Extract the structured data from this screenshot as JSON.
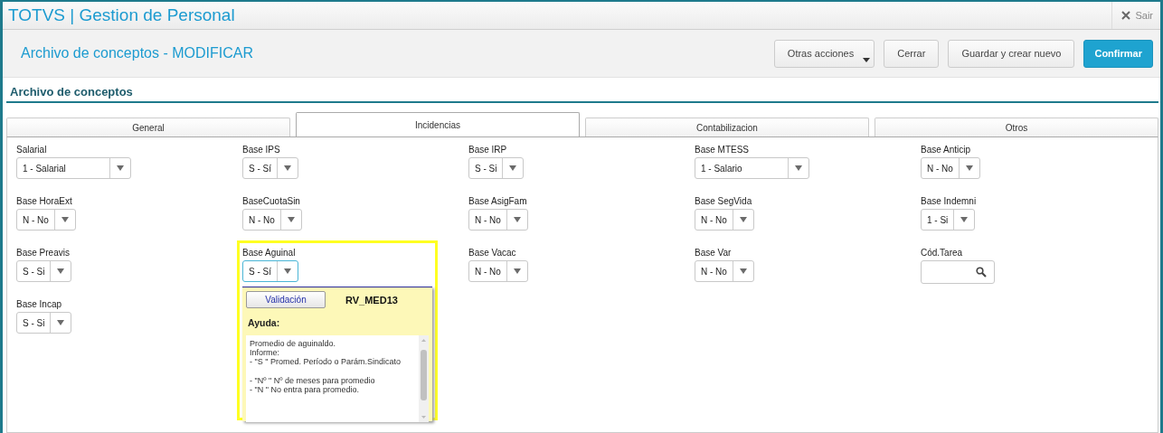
{
  "app_bar": {
    "title": "TOTVS | Gestion de Personal",
    "exit_label": "Sair"
  },
  "header": {
    "title": "Archivo de conceptos - MODIFICAR",
    "buttons": [
      {
        "label": "Otras acciones",
        "kind": "menu"
      },
      {
        "label": "Cerrar",
        "kind": "plain"
      },
      {
        "label": "Guardar y crear nuevo",
        "kind": "plain"
      },
      {
        "label": "Confirmar",
        "kind": "primary"
      }
    ]
  },
  "section_title": "Archivo de conceptos",
  "tabs": [
    {
      "label": "General",
      "selected": false
    },
    {
      "label": "Incidencias",
      "selected": true
    },
    {
      "label": "Contabilizacion",
      "selected": false
    },
    {
      "label": "Otros",
      "selected": false
    }
  ],
  "fields": [
    {
      "label": "Salarial",
      "value": "1 - Salarial",
      "kind": "select",
      "focused": false
    },
    {
      "label": "Base IPS",
      "value": "S - Sí",
      "kind": "select",
      "focused": false
    },
    {
      "label": "Base IRP",
      "value": "S - Si",
      "kind": "select",
      "focused": false
    },
    {
      "label": "Base MTESS",
      "value": "1 - Salario",
      "kind": "select",
      "focused": false
    },
    {
      "label": "Base Anticip",
      "value": "N - No",
      "kind": "select",
      "focused": false
    },
    {
      "label": "Base HoraExt",
      "value": "N - No",
      "kind": "select",
      "focused": false
    },
    {
      "label": "BaseCuotaSin",
      "value": "N - No",
      "kind": "select",
      "focused": false
    },
    {
      "label": "Base AsigFam",
      "value": "N - No",
      "kind": "select",
      "focused": false
    },
    {
      "label": "Base SegVida",
      "value": "N - No",
      "kind": "select",
      "focused": false
    },
    {
      "label": "Base Indemni",
      "value": "1 - Si",
      "kind": "select",
      "focused": false
    },
    {
      "label": "Base Preavis",
      "value": "S - Si",
      "kind": "select",
      "focused": false
    },
    {
      "label": "Base Aguinal",
      "value": "S - Sí",
      "kind": "select",
      "focused": true
    },
    {
      "label": "Base Vacac",
      "value": "N - No",
      "kind": "select",
      "focused": false
    },
    {
      "label": "Base Var",
      "value": "N - No",
      "kind": "select",
      "focused": false
    },
    {
      "label": "Cód.Tarea",
      "kind": "search"
    },
    {
      "label": "Base Incap",
      "value": "S - Si",
      "kind": "select",
      "focused": false
    }
  ],
  "help_popup": {
    "button": "Validación",
    "code": "RV_MED13",
    "heading": "Ayuda:",
    "text": "Promedio de aguinaldo.\nInforme:\n- \"S \" Promed. Período o Parám.Sindicato\n\n- \"Nº \" Nº de meses para promedio\n- \"N \" No entra para promedio."
  }
}
